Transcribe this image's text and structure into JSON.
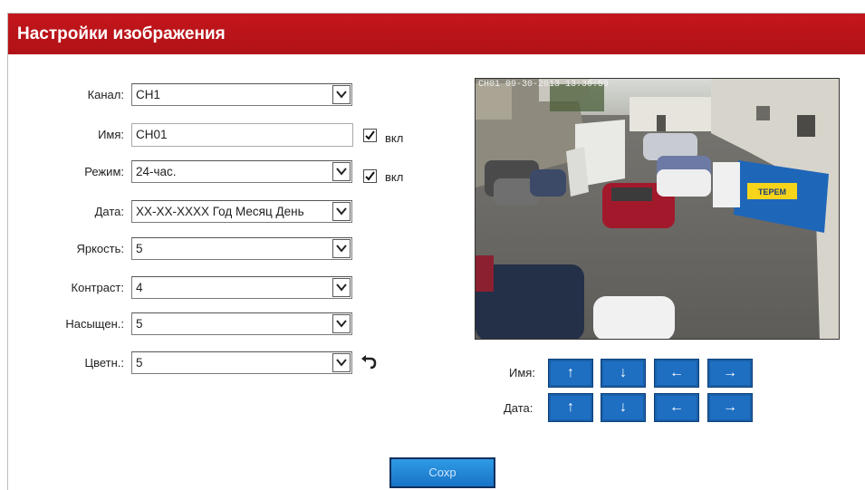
{
  "header": {
    "title": "Настройки изображения"
  },
  "form": {
    "channel": {
      "label": "Канал:",
      "value": "CH1"
    },
    "name": {
      "label": "Имя:",
      "value": "CH01",
      "enable_label": "вкл"
    },
    "mode": {
      "label": "Режим:",
      "value": "24-час.",
      "enable_label": "вкл"
    },
    "date": {
      "label": "Дата:",
      "value": "XX-XX-XXXX Год Месяц День"
    },
    "brightness": {
      "label": "Яркость:",
      "value": "5"
    },
    "contrast": {
      "label": "Контраст:",
      "value": "4"
    },
    "saturation": {
      "label": "Насыщен.:",
      "value": "5"
    },
    "hue": {
      "label": "Цветн.:",
      "value": "5"
    }
  },
  "preview": {
    "osd_text": "CH01  09-30-2013 13:30:59",
    "truck_sign": "ТЕРЕМ"
  },
  "position": {
    "name_label": "Имя:",
    "date_label": "Дата:",
    "up": "↑",
    "down": "↓",
    "left": "←",
    "right": "→"
  },
  "actions": {
    "save_label": "Сохр"
  },
  "icons": {
    "dropdown": "chevron-down-icon",
    "checkbox": "check-icon",
    "reset": "undo-icon"
  },
  "colors": {
    "header": "#c4161c",
    "button": "#1e6fc2"
  }
}
